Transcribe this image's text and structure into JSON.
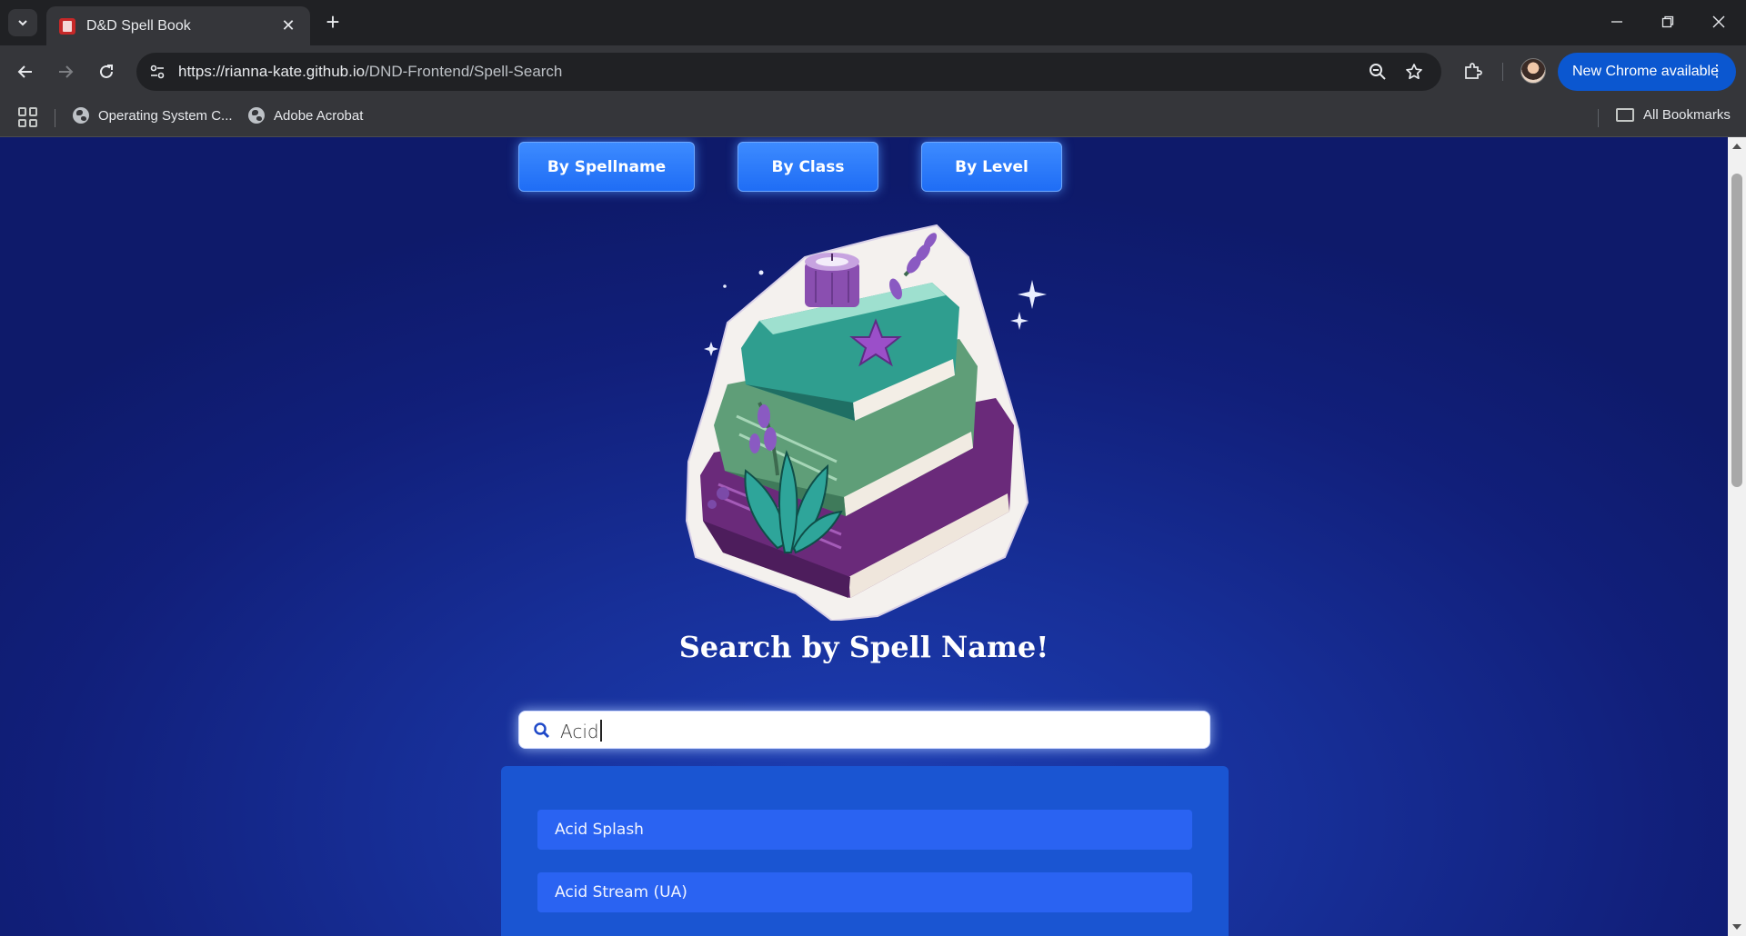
{
  "browser": {
    "tab_title": "D&D Spell Book",
    "url_domain": "https://rianna-kate.github.io",
    "url_path": "/DND-Frontend/Spell-Search",
    "update_label": "New Chrome available",
    "bookmarks": [
      {
        "label": "Operating System C..."
      },
      {
        "label": "Adobe Acrobat"
      }
    ],
    "all_bookmarks_label": "All Bookmarks"
  },
  "page": {
    "mode_buttons": [
      {
        "label": "By Spellname"
      },
      {
        "label": "By Class"
      },
      {
        "label": "By Level"
      }
    ],
    "heading": "Search by Spell Name!",
    "search": {
      "value": "Acid",
      "icon": "search-icon"
    },
    "results": [
      {
        "label": "Acid Splash"
      },
      {
        "label": "Acid Stream (UA)"
      }
    ],
    "illustration": "stack-of-books-with-candle-and-lavender"
  },
  "colors": {
    "page_bg": "#172f98",
    "button_blue": "#1f6df5",
    "results_panel": "#1a55d2",
    "result_item": "#2a63f2"
  }
}
